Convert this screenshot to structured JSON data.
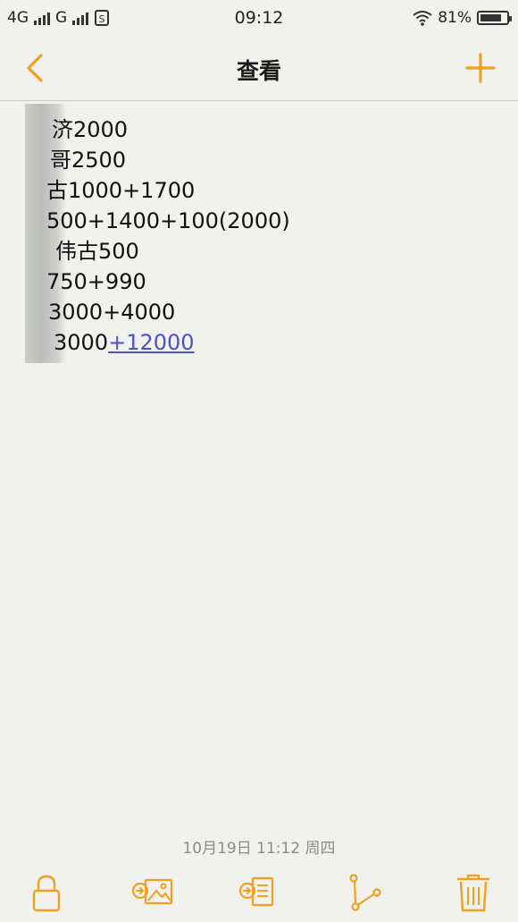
{
  "status": {
    "carrier1": "4G",
    "carrier2": "G",
    "sim_icon": "sim-card-icon",
    "time": "09:12",
    "battery_percent": "81%",
    "battery_level": 0.81
  },
  "nav": {
    "title": "查看",
    "back_icon": "chevron-left-icon",
    "add_icon": "plus-icon",
    "accent": "#f0a020"
  },
  "note": {
    "lines": [
      "济2000",
      "哥2500",
      "古1000+1700",
      "500+1400+100(2000)",
      "伟古500",
      "750+990",
      "3000+4000",
      "3000"
    ],
    "last_line_link": "+12000"
  },
  "footer": {
    "timestamp": "10月19日 11:12 周四"
  },
  "toolbar": {
    "items": [
      "lock-icon",
      "insert-image-icon",
      "insert-list-icon",
      "share-icon",
      "trash-icon"
    ]
  }
}
